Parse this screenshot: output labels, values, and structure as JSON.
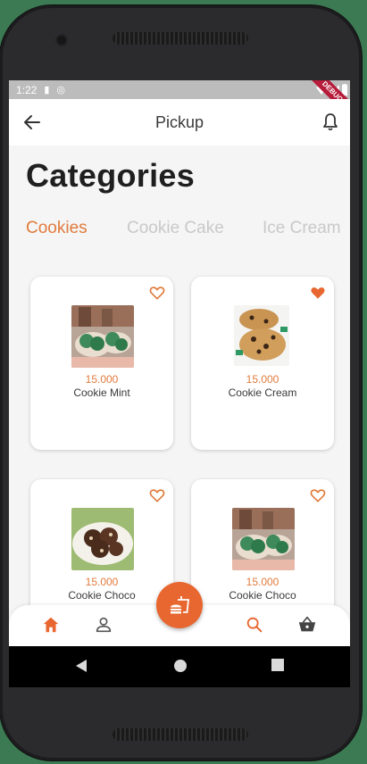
{
  "status_bar": {
    "time": "1:22",
    "debug_label": "DEBUG"
  },
  "app_bar": {
    "title": "Pickup"
  },
  "heading": "Categories",
  "tabs": [
    {
      "label": "Cookies",
      "active": true
    },
    {
      "label": "Cookie Cake",
      "active": false
    },
    {
      "label": "Ice Cream",
      "active": false
    }
  ],
  "products": [
    {
      "price": "15.000",
      "name": "Cookie Mint",
      "favorite": false,
      "image": "green-cookies-photo"
    },
    {
      "price": "15.000",
      "name": "Cookie Cream",
      "favorite": true,
      "image": "chocolate-chip-cookie-photo"
    },
    {
      "price": "15.000",
      "name": "Cookie Choco",
      "favorite": false,
      "image": "chocolate-cookies-plate-photo"
    },
    {
      "price": "15.000",
      "name": "Cookie Choco",
      "favorite": false,
      "image": "green-cookies-photo"
    }
  ],
  "bottom_nav": {
    "items": [
      "home-icon",
      "profile-icon",
      "search-icon",
      "basket-icon"
    ],
    "active": "home-icon",
    "fab_icon": "fast-food-icon"
  },
  "colors": {
    "accent": "#e07b3c",
    "fab": "#e8662f",
    "tab_inactive": "#c9c9c9"
  }
}
